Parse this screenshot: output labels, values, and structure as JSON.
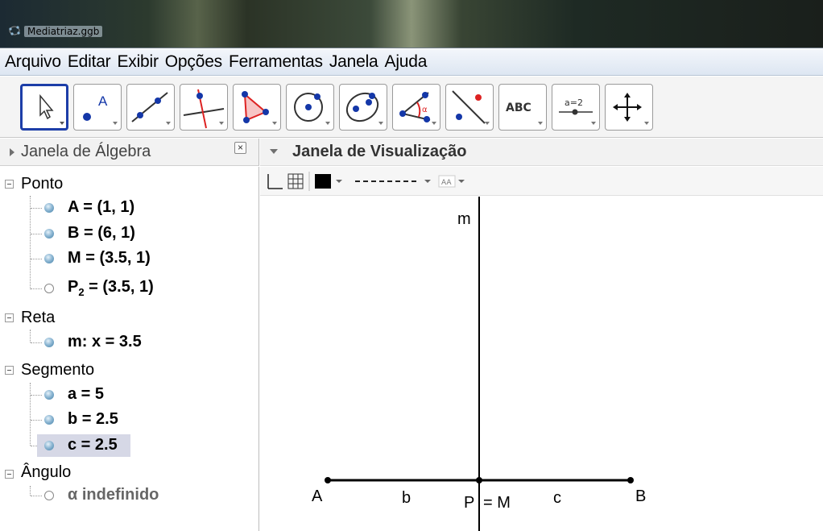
{
  "window": {
    "title": "Mediatriaz.ggb"
  },
  "menu": [
    "Arquivo",
    "Editar",
    "Exibir",
    "Opções",
    "Ferramentas",
    "Janela",
    "Ajuda"
  ],
  "toolbar": {
    "tools": [
      {
        "name": "move-tool",
        "icon": "arrow-cursor-icon",
        "selected": true
      },
      {
        "name": "point-tool",
        "icon": "point-icon",
        "label": "A"
      },
      {
        "name": "line-tool",
        "icon": "line-through-two-points-icon"
      },
      {
        "name": "perpendicular-tool",
        "icon": "perpendicular-line-icon"
      },
      {
        "name": "polygon-tool",
        "icon": "polygon-icon"
      },
      {
        "name": "circle-tool",
        "icon": "circle-center-point-icon"
      },
      {
        "name": "ellipse-tool",
        "icon": "ellipse-icon"
      },
      {
        "name": "angle-tool",
        "icon": "angle-icon",
        "label": "α"
      },
      {
        "name": "reflect-tool",
        "icon": "reflect-about-line-icon"
      },
      {
        "name": "text-tool",
        "icon": "text-icon",
        "label": "ABC"
      },
      {
        "name": "slider-tool",
        "icon": "slider-icon",
        "label": "a=2"
      },
      {
        "name": "move-view-tool",
        "icon": "move-graphics-view-icon"
      }
    ]
  },
  "algebra": {
    "header": "Janela de Álgebra",
    "groups": [
      {
        "title": "Ponto",
        "items": [
          {
            "text": "A = (1, 1)",
            "state": "visible"
          },
          {
            "text": "B = (6, 1)",
            "state": "visible"
          },
          {
            "text": "M = (3.5, 1)",
            "state": "visible"
          },
          {
            "prefix": "P",
            "sub": "2",
            "suffix": " = (3.5, 1)",
            "state": "hidden"
          }
        ]
      },
      {
        "title": "Reta",
        "items": [
          {
            "text": "m: x = 3.5",
            "state": "visible"
          }
        ]
      },
      {
        "title": "Segmento",
        "items": [
          {
            "text": "a = 5",
            "state": "visible"
          },
          {
            "text": "b = 2.5",
            "state": "visible"
          },
          {
            "text": "c = 2.5",
            "state": "visible",
            "selected": true
          }
        ]
      },
      {
        "title": "Ângulo",
        "items": [
          {
            "text": "α indefinido",
            "state": "hidden",
            "undefined": true
          }
        ]
      }
    ]
  },
  "graphics": {
    "header": "Janela de Visualização",
    "style_bar": {
      "icons": [
        "axes-icon",
        "grid-icon",
        "color-swatch-icon",
        "line-style-icon",
        "label-size-icon"
      ],
      "label_size_text": "AA"
    },
    "labels": {
      "line_m": "m",
      "point_a": "A",
      "point_b": "B",
      "seg_b": "b",
      "seg_c": "c",
      "p_equals_m_left": "P",
      "p_equals_m_right": "= M"
    }
  }
}
